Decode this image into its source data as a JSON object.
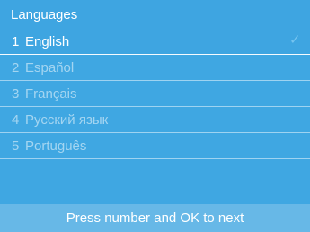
{
  "header": {
    "title": "Languages"
  },
  "languages": [
    {
      "number": "1",
      "name": "English",
      "selected": true
    },
    {
      "number": "2",
      "name": "Español",
      "selected": false
    },
    {
      "number": "3",
      "name": "Français",
      "selected": false
    },
    {
      "number": "4",
      "name": "Русский язык",
      "selected": false
    },
    {
      "number": "5",
      "name": "Português",
      "selected": false
    }
  ],
  "footer": {
    "hint": "Press number and OK to next"
  },
  "icons": {
    "selected_marker": "checkmark-icon"
  },
  "colors": {
    "background": "#3fa7e2",
    "footer_background": "#67b8e7",
    "text": "#ffffff",
    "divider": "#f6fbff",
    "checkmark": "#75c4f0"
  }
}
